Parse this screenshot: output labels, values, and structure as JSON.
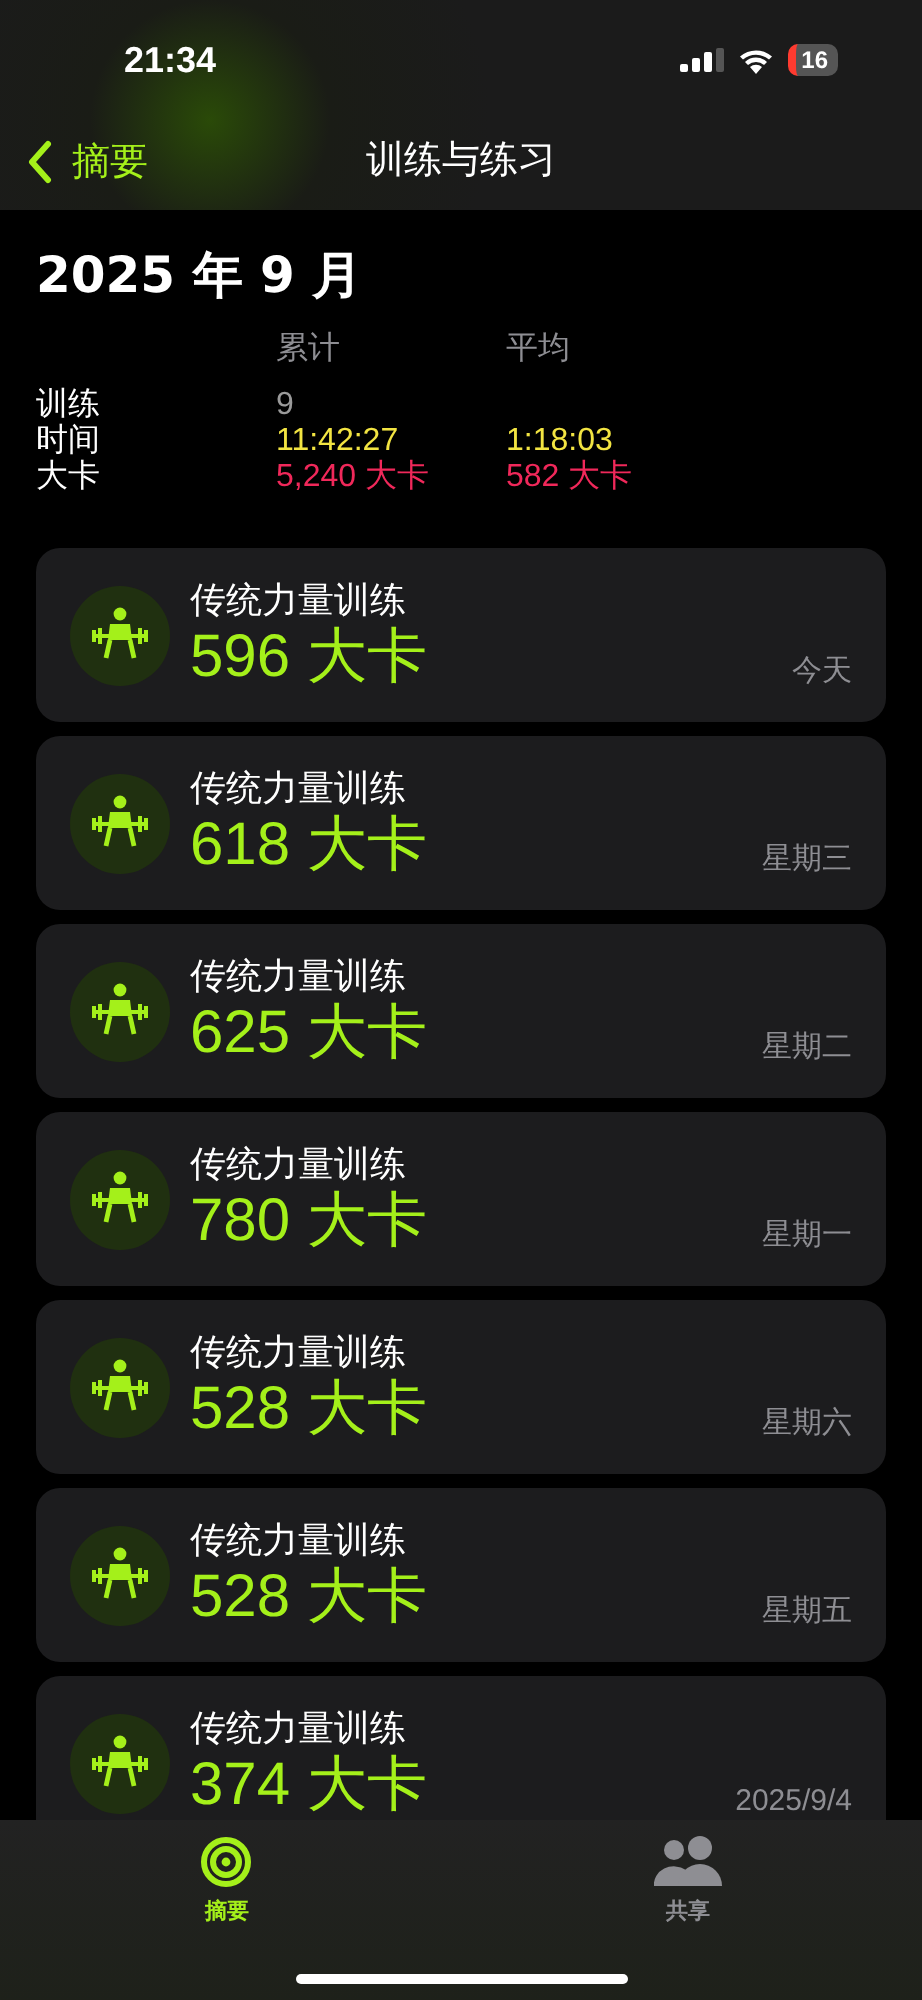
{
  "status_bar": {
    "time": "21:34",
    "battery": "16"
  },
  "nav": {
    "back": "摘要",
    "title": "训练与练习"
  },
  "month": "2025 年 9 月",
  "stats": {
    "columns": [
      "累计",
      "平均"
    ],
    "rows": [
      {
        "label": "训练",
        "kind": "count",
        "values": [
          "9"
        ]
      },
      {
        "label": "时间",
        "kind": "time",
        "values": [
          "11:42:27",
          "1:18:03"
        ]
      },
      {
        "label": "大卡",
        "kind": "energy",
        "values": [
          "5,240 大卡",
          "582 大卡"
        ]
      }
    ]
  },
  "workouts": [
    {
      "name": "传统力量训练",
      "calories": "596 大卡",
      "day": "今天"
    },
    {
      "name": "传统力量训练",
      "calories": "618 大卡",
      "day": "星期三"
    },
    {
      "name": "传统力量训练",
      "calories": "625 大卡",
      "day": "星期二"
    },
    {
      "name": "传统力量训练",
      "calories": "780 大卡",
      "day": "星期一"
    },
    {
      "name": "传统力量训练",
      "calories": "528 大卡",
      "day": "星期六"
    },
    {
      "name": "传统力量训练",
      "calories": "528 大卡",
      "day": "星期五"
    },
    {
      "name": "传统力量训练",
      "calories": "374 大卡",
      "day": "2025/9/4"
    }
  ],
  "tabs": [
    {
      "label": "摘要",
      "kind": "summary",
      "selected": true
    },
    {
      "label": "共享",
      "kind": "sharing",
      "selected": false
    }
  ]
}
